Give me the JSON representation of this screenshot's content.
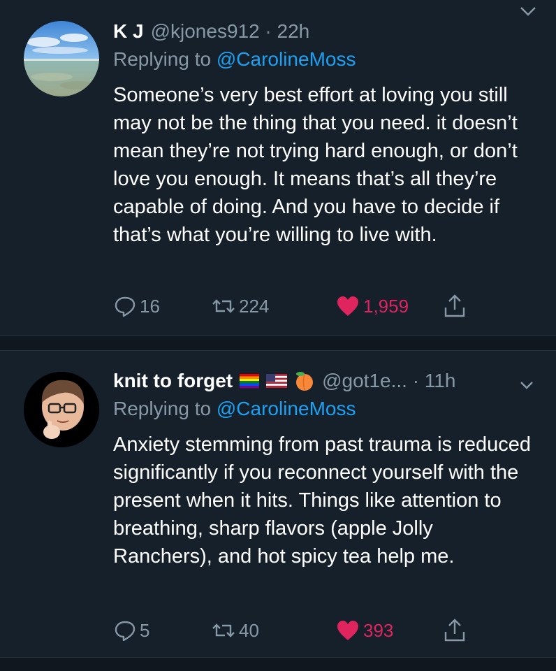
{
  "colors": {
    "background": "#15202b",
    "separator": "#10171e",
    "text": "#ffffff",
    "muted": "#8899a6",
    "accent": "#1da1f2",
    "like": "#e0245e"
  },
  "tweets": [
    {
      "display_name": "K J",
      "handle_time": "@kjones912 · 22h",
      "reply_prefix": "Replying to",
      "reply_mention": "@CarolineMoss",
      "avatar": "beach-photo",
      "body": "Someone’s very best effort at loving you still may not be the thing that you need. it doesn’t mean they’re not trying hard enough, or don’t love you enough. It means that’s all they’re capable of doing. And you have to decide if that’s what you’re willing to live with.",
      "replies": "16",
      "retweets": "224",
      "likes": "1,959",
      "liked": true,
      "icons": [
        "reply-icon",
        "retweet-icon",
        "heart-icon",
        "share-icon",
        "chevron-down-icon"
      ]
    },
    {
      "display_name": "knit to forget",
      "badges": [
        "rainbow-flag-emoji",
        "us-flag-emoji",
        "peach-emoji"
      ],
      "handle_time": "@got1e... · 11h",
      "reply_prefix": "Replying to",
      "reply_mention": "@CarolineMoss",
      "avatar": "memoji-thinking",
      "body": "Anxiety stemming from past trauma is reduced significantly if you reconnect yourself with the present when it hits. Things like attention to breathing, sharp flavors (apple Jolly Ranchers), and hot spicy tea help me.",
      "replies": "5",
      "retweets": "40",
      "likes": "393",
      "liked": true,
      "icons": [
        "reply-icon",
        "retweet-icon",
        "heart-icon",
        "share-icon",
        "chevron-down-icon"
      ]
    }
  ]
}
